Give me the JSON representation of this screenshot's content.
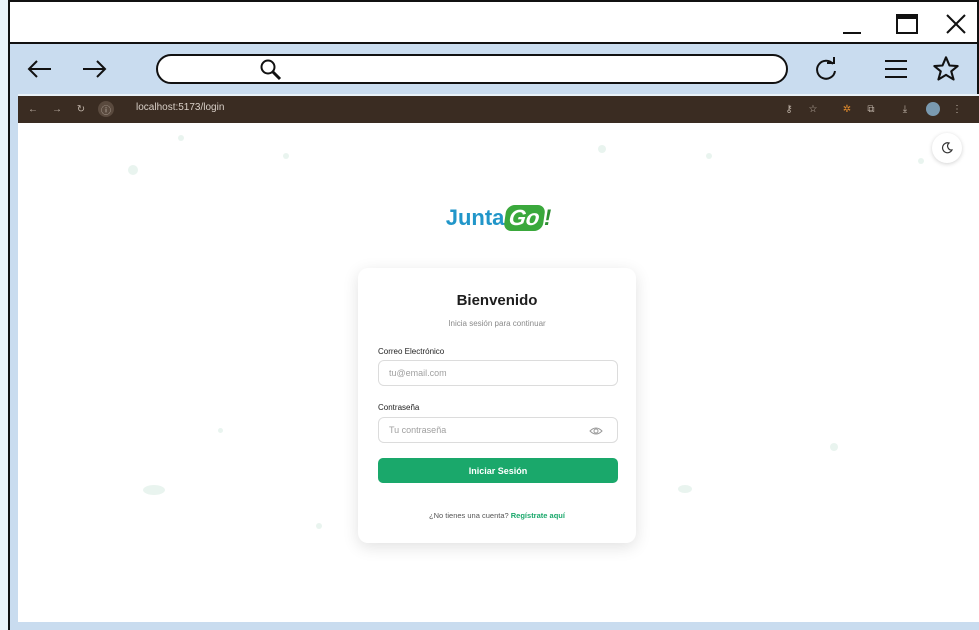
{
  "window": {
    "minimize_icon": "minimize-icon",
    "maximize_icon": "maximize-icon",
    "close_icon": "close-icon"
  },
  "outer_toolbar": {
    "back_icon": "arrow-left-icon",
    "forward_icon": "arrow-right-icon",
    "search_icon": "search-icon",
    "reload_icon": "reload-icon",
    "menu_icon": "hamburger-menu-icon",
    "bookmark_icon": "star-icon"
  },
  "inner_browser": {
    "url": "localhost:5173/login"
  },
  "page": {
    "logo": {
      "text_main": "Junta",
      "text_accent": "Go",
      "text_bang": "!"
    },
    "title": "Bienvenido",
    "subtitle": "Inicia sesión para continuar",
    "email": {
      "label": "Correo Electrónico",
      "placeholder": "tu@email.com",
      "value": ""
    },
    "password": {
      "label": "Contraseña",
      "placeholder": "Tu contraseña",
      "value": ""
    },
    "submit_label": "Iniciar Sesión",
    "register_prompt": "¿No tienes una cuenta?",
    "register_link": "Regístrate aquí"
  },
  "colors": {
    "brand_green": "#1aa86b",
    "logo_blue": "#2196c9",
    "logo_green": "#3aa83c",
    "toolbar_bg": "#c9dcef",
    "inner_chrome_bg": "#3a2c22"
  }
}
